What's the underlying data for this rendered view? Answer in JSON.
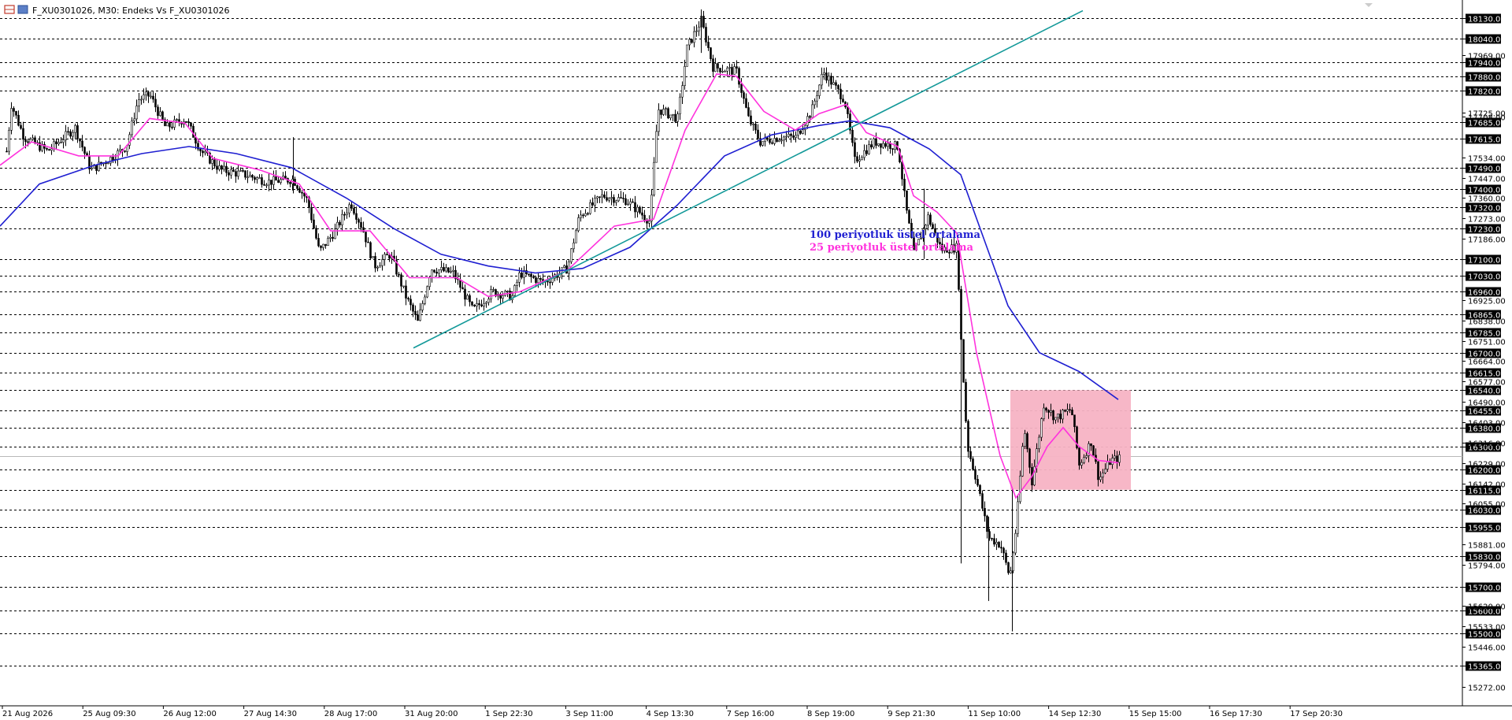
{
  "header": {
    "title": "F_XU0301026, M30:  Endeks Vs F_XU0301026"
  },
  "colors": {
    "ema100": "#1f1fd1",
    "ema25": "#ff33dd",
    "trendline": "#139999",
    "box_fill": "#f7b3c4",
    "candle": "#000000",
    "grid": "#000000",
    "label_bg": "#000000",
    "label_fg": "#ffffff"
  },
  "annotations": {
    "ema100_label": "100 periyotluk üstel ortalama",
    "ema25_label": "25 periyotluk üstel ortalama"
  },
  "chart_data": {
    "type": "candlestick",
    "ylim": [
      15220,
      18160
    ],
    "x_labels": [
      "21 Aug 2026",
      "25 Aug 09:30",
      "26 Aug 12:00",
      "27 Aug 14:30",
      "28 Aug 17:00",
      "31 Aug 20:00",
      "1 Sep 22:30",
      "3 Sep 11:00",
      "4 Sep 13:30",
      "7 Sep 16:00",
      "8 Sep 19:00",
      "9 Sep 21:30",
      "11 Sep 10:00",
      "14 Sep 12:30",
      "15 Sep 15:00",
      "16 Sep 17:30",
      "17 Sep 20:30"
    ],
    "y_ticks_boxed": [
      18130,
      18040,
      17940,
      17880,
      17820,
      17685,
      17615,
      17490,
      17400,
      17320,
      17230,
      17100,
      17030,
      16960,
      16865,
      16785,
      16700,
      16615,
      16540,
      16455,
      16380,
      16300,
      16200,
      16115,
      16030,
      15955,
      15830,
      15700,
      15600,
      15500,
      15365
    ],
    "y_ticks_plain": [
      17969,
      17725,
      17708,
      17534,
      17447,
      17360,
      17273,
      17186,
      16925,
      16838,
      16751,
      16664,
      16577,
      16490,
      16403,
      16316,
      16229,
      16142,
      16055,
      15881,
      15794,
      15620,
      15533,
      15446,
      15272
    ],
    "price_path": [
      {
        "x": 8,
        "y": 17560
      },
      {
        "x": 14,
        "y": 17760
      },
      {
        "x": 30,
        "y": 17620
      },
      {
        "x": 60,
        "y": 17560
      },
      {
        "x": 95,
        "y": 17660
      },
      {
        "x": 115,
        "y": 17480
      },
      {
        "x": 140,
        "y": 17530
      },
      {
        "x": 160,
        "y": 17580
      },
      {
        "x": 175,
        "y": 17780
      },
      {
        "x": 190,
        "y": 17800
      },
      {
        "x": 210,
        "y": 17660
      },
      {
        "x": 235,
        "y": 17700
      },
      {
        "x": 255,
        "y": 17560
      },
      {
        "x": 280,
        "y": 17480
      },
      {
        "x": 310,
        "y": 17460
      },
      {
        "x": 340,
        "y": 17430
      },
      {
        "x": 372,
        "y": 17440
      },
      {
        "x": 390,
        "y": 17350
      },
      {
        "x": 405,
        "y": 17130
      },
      {
        "x": 425,
        "y": 17220
      },
      {
        "x": 445,
        "y": 17340
      },
      {
        "x": 460,
        "y": 17230
      },
      {
        "x": 475,
        "y": 17070
      },
      {
        "x": 495,
        "y": 17120
      },
      {
        "x": 515,
        "y": 16940
      },
      {
        "x": 530,
        "y": 16830
      },
      {
        "x": 547,
        "y": 17060
      },
      {
        "x": 575,
        "y": 17040
      },
      {
        "x": 600,
        "y": 16880
      },
      {
        "x": 625,
        "y": 16960
      },
      {
        "x": 650,
        "y": 16940
      },
      {
        "x": 660,
        "y": 17040
      },
      {
        "x": 690,
        "y": 17000
      },
      {
        "x": 720,
        "y": 17060
      },
      {
        "x": 735,
        "y": 17280
      },
      {
        "x": 765,
        "y": 17370
      },
      {
        "x": 795,
        "y": 17350
      },
      {
        "x": 825,
        "y": 17260
      },
      {
        "x": 835,
        "y": 17740
      },
      {
        "x": 860,
        "y": 17700
      },
      {
        "x": 872,
        "y": 18000
      },
      {
        "x": 890,
        "y": 18120
      },
      {
        "x": 905,
        "y": 17920
      },
      {
        "x": 935,
        "y": 17900
      },
      {
        "x": 950,
        "y": 17700
      },
      {
        "x": 965,
        "y": 17600
      },
      {
        "x": 990,
        "y": 17620
      },
      {
        "x": 1010,
        "y": 17620
      },
      {
        "x": 1030,
        "y": 17730
      },
      {
        "x": 1045,
        "y": 17900
      },
      {
        "x": 1072,
        "y": 17780
      },
      {
        "x": 1085,
        "y": 17520
      },
      {
        "x": 1110,
        "y": 17600
      },
      {
        "x": 1140,
        "y": 17580
      },
      {
        "x": 1150,
        "y": 17320
      },
      {
        "x": 1160,
        "y": 17120
      },
      {
        "x": 1178,
        "y": 17280
      },
      {
        "x": 1195,
        "y": 17140
      },
      {
        "x": 1215,
        "y": 17150
      },
      {
        "x": 1220,
        "y": 16750
      },
      {
        "x": 1228,
        "y": 16300
      },
      {
        "x": 1240,
        "y": 16150
      },
      {
        "x": 1255,
        "y": 15910
      },
      {
        "x": 1270,
        "y": 15880
      },
      {
        "x": 1282,
        "y": 15740
      },
      {
        "x": 1290,
        "y": 15960
      },
      {
        "x": 1300,
        "y": 16380
      },
      {
        "x": 1310,
        "y": 16150
      },
      {
        "x": 1325,
        "y": 16480
      },
      {
        "x": 1340,
        "y": 16420
      },
      {
        "x": 1360,
        "y": 16460
      },
      {
        "x": 1370,
        "y": 16220
      },
      {
        "x": 1385,
        "y": 16320
      },
      {
        "x": 1395,
        "y": 16160
      },
      {
        "x": 1410,
        "y": 16240
      },
      {
        "x": 1422,
        "y": 16250
      }
    ],
    "ema100": [
      {
        "x": 0,
        "y": 17240
      },
      {
        "x": 50,
        "y": 17420
      },
      {
        "x": 120,
        "y": 17500
      },
      {
        "x": 180,
        "y": 17550
      },
      {
        "x": 240,
        "y": 17580
      },
      {
        "x": 300,
        "y": 17550
      },
      {
        "x": 370,
        "y": 17490
      },
      {
        "x": 440,
        "y": 17360
      },
      {
        "x": 500,
        "y": 17230
      },
      {
        "x": 560,
        "y": 17120
      },
      {
        "x": 620,
        "y": 17070
      },
      {
        "x": 680,
        "y": 17040
      },
      {
        "x": 740,
        "y": 17060
      },
      {
        "x": 800,
        "y": 17150
      },
      {
        "x": 860,
        "y": 17330
      },
      {
        "x": 920,
        "y": 17540
      },
      {
        "x": 980,
        "y": 17630
      },
      {
        "x": 1040,
        "y": 17670
      },
      {
        "x": 1080,
        "y": 17690
      },
      {
        "x": 1130,
        "y": 17660
      },
      {
        "x": 1180,
        "y": 17570
      },
      {
        "x": 1220,
        "y": 17460
      },
      {
        "x": 1250,
        "y": 17180
      },
      {
        "x": 1280,
        "y": 16900
      },
      {
        "x": 1320,
        "y": 16700
      },
      {
        "x": 1370,
        "y": 16620
      },
      {
        "x": 1420,
        "y": 16500
      }
    ],
    "ema25": [
      {
        "x": 0,
        "y": 17500
      },
      {
        "x": 40,
        "y": 17600
      },
      {
        "x": 100,
        "y": 17540
      },
      {
        "x": 150,
        "y": 17540
      },
      {
        "x": 190,
        "y": 17700
      },
      {
        "x": 235,
        "y": 17680
      },
      {
        "x": 270,
        "y": 17530
      },
      {
        "x": 330,
        "y": 17480
      },
      {
        "x": 380,
        "y": 17420
      },
      {
        "x": 420,
        "y": 17220
      },
      {
        "x": 470,
        "y": 17220
      },
      {
        "x": 520,
        "y": 17020
      },
      {
        "x": 580,
        "y": 17020
      },
      {
        "x": 620,
        "y": 16940
      },
      {
        "x": 660,
        "y": 16960
      },
      {
        "x": 720,
        "y": 17050
      },
      {
        "x": 780,
        "y": 17240
      },
      {
        "x": 830,
        "y": 17270
      },
      {
        "x": 870,
        "y": 17650
      },
      {
        "x": 910,
        "y": 17890
      },
      {
        "x": 935,
        "y": 17880
      },
      {
        "x": 970,
        "y": 17730
      },
      {
        "x": 1010,
        "y": 17650
      },
      {
        "x": 1040,
        "y": 17720
      },
      {
        "x": 1075,
        "y": 17760
      },
      {
        "x": 1100,
        "y": 17640
      },
      {
        "x": 1140,
        "y": 17580
      },
      {
        "x": 1160,
        "y": 17370
      },
      {
        "x": 1190,
        "y": 17300
      },
      {
        "x": 1215,
        "y": 17210
      },
      {
        "x": 1240,
        "y": 16700
      },
      {
        "x": 1270,
        "y": 16260
      },
      {
        "x": 1290,
        "y": 16080
      },
      {
        "x": 1310,
        "y": 16170
      },
      {
        "x": 1330,
        "y": 16300
      },
      {
        "x": 1350,
        "y": 16380
      },
      {
        "x": 1370,
        "y": 16300
      },
      {
        "x": 1395,
        "y": 16240
      },
      {
        "x": 1420,
        "y": 16230
      }
    ],
    "trendline": {
      "from": {
        "x": 525,
        "y": 16720
      },
      "to": {
        "x": 1375,
        "y": 18160
      }
    },
    "range_box": {
      "x_from": 1283,
      "x_to": 1436,
      "y_top": 16540,
      "y_bottom": 16115
    }
  }
}
